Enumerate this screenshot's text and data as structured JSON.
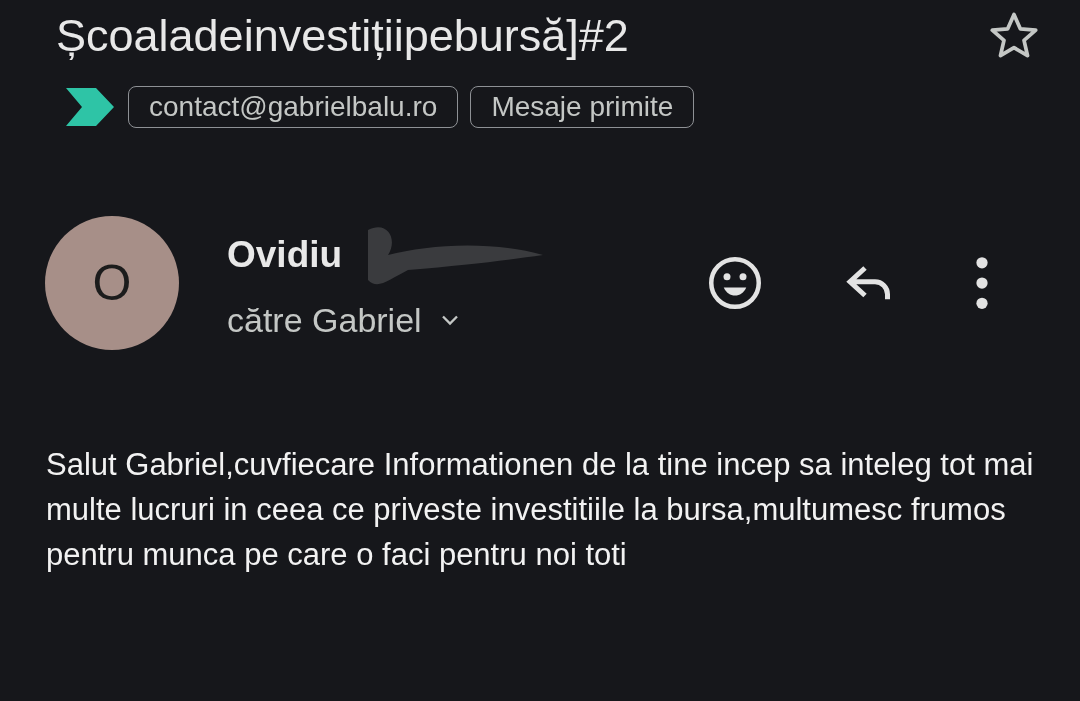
{
  "subject": "Școaladeinvestițiipebursă]#2",
  "starred": false,
  "labels": [
    {
      "text": "contact@gabrielbalu.ro"
    },
    {
      "text": "Mesaje primite"
    }
  ],
  "message": {
    "avatar_letter": "O",
    "sender": "Ovidiu",
    "recipient": "către Gabriel",
    "body": "Salut Gabriel,cuvfiecare Informationen de la tine incep sa inteleg tot mai multe lucruri in ceea ce priveste investitiile la bursa,multumesc frumos pentru munca pe care o faci pentru noi toti"
  }
}
